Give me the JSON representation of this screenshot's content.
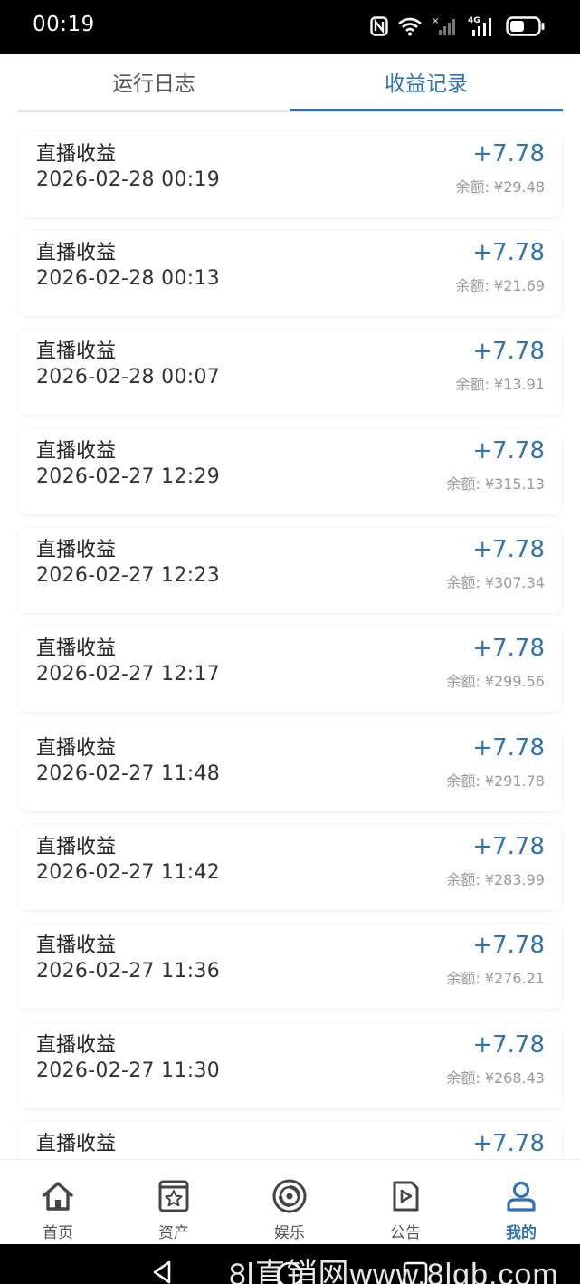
{
  "status_bar": {
    "time": "00:19",
    "network": "4G"
  },
  "tabs": [
    {
      "label": "运行日志",
      "active": false
    },
    {
      "label": "收益记录",
      "active": true
    }
  ],
  "records": [
    {
      "title": "直播收益",
      "time": "2026-02-28 00:19",
      "amount": "+7.78",
      "balance": "余额: ¥29.48"
    },
    {
      "title": "直播收益",
      "time": "2026-02-28 00:13",
      "amount": "+7.78",
      "balance": "余额: ¥21.69"
    },
    {
      "title": "直播收益",
      "time": "2026-02-28 00:07",
      "amount": "+7.78",
      "balance": "余额: ¥13.91"
    },
    {
      "title": "直播收益",
      "time": "2026-02-27 12:29",
      "amount": "+7.78",
      "balance": "余额: ¥315.13"
    },
    {
      "title": "直播收益",
      "time": "2026-02-27 12:23",
      "amount": "+7.78",
      "balance": "余额: ¥307.34"
    },
    {
      "title": "直播收益",
      "time": "2026-02-27 12:17",
      "amount": "+7.78",
      "balance": "余额: ¥299.56"
    },
    {
      "title": "直播收益",
      "time": "2026-02-27 11:48",
      "amount": "+7.78",
      "balance": "余额: ¥291.78"
    },
    {
      "title": "直播收益",
      "time": "2026-02-27 11:42",
      "amount": "+7.78",
      "balance": "余额: ¥283.99"
    },
    {
      "title": "直播收益",
      "time": "2026-02-27 11:36",
      "amount": "+7.78",
      "balance": "余额: ¥276.21"
    },
    {
      "title": "直播收益",
      "time": "2026-02-27 11:30",
      "amount": "+7.78",
      "balance": "余额: ¥268.43"
    },
    {
      "title": "直播收益",
      "time": "",
      "amount": "+7.78",
      "balance": ""
    }
  ],
  "bottom_nav": [
    {
      "label": "首页",
      "icon": "home-icon",
      "active": false
    },
    {
      "label": "资产",
      "icon": "assets-icon",
      "active": false
    },
    {
      "label": "娱乐",
      "icon": "entertainment-icon",
      "active": false
    },
    {
      "label": "公告",
      "icon": "announcement-icon",
      "active": false
    },
    {
      "label": "我的",
      "icon": "profile-icon",
      "active": true
    }
  ],
  "watermark": "8l直销网www.8lgb.com",
  "colors": {
    "accent": "#2f73b0",
    "text_primary": "#222222",
    "text_secondary": "#9a9a9a",
    "background": "#f4f5f7"
  }
}
